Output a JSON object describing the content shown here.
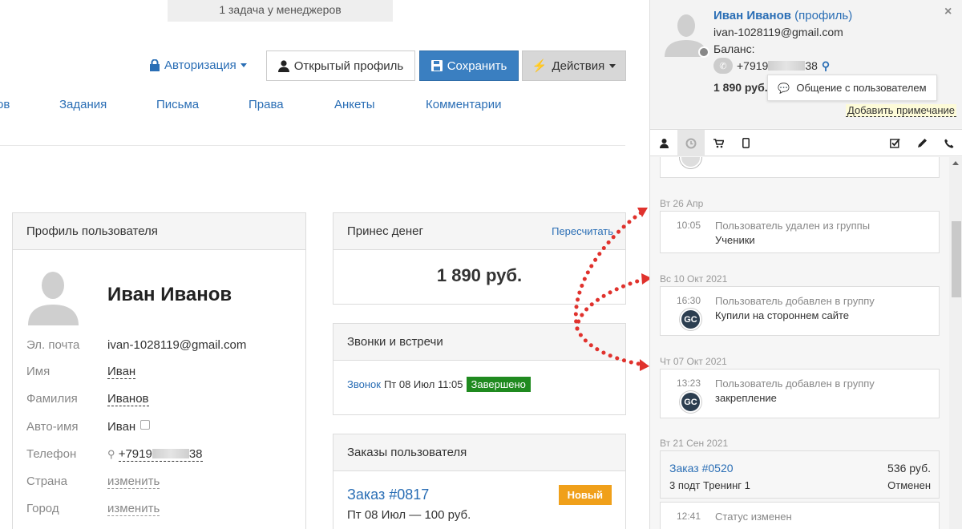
{
  "banner": {
    "text": "1 задача у менеджеров"
  },
  "toolbar": {
    "auth_label": "Авторизация",
    "open_profile_label": "Открытый профиль",
    "save_label": "Сохранить",
    "actions_label": "Действия"
  },
  "nav": {
    "items": [
      "ов",
      "Задания",
      "Письма",
      "Права",
      "Анкеты",
      "Комментарии"
    ]
  },
  "profile": {
    "title": "Профиль пользователя",
    "name": "Иван Иванов",
    "fields": [
      {
        "label": "Эл. почта",
        "value": "ivan-1028119@gmail.com"
      },
      {
        "label": "Имя",
        "value": "Иван"
      },
      {
        "label": "Фамилия",
        "value": "Иванов"
      },
      {
        "label": "Авто-имя",
        "value": "Иван"
      },
      {
        "label": "Телефон",
        "prefix": "+7919",
        "suffix": "38"
      },
      {
        "label": "Страна",
        "value": "изменить"
      },
      {
        "label": "Город",
        "value": "изменить"
      }
    ]
  },
  "money": {
    "title": "Принес денег",
    "recalc": "Пересчитать",
    "value": "1 890 руб."
  },
  "calls": {
    "title": "Звонки и встречи",
    "link": "Звонок",
    "date": "Пт 08 Июл 11:05",
    "status": "Завершено"
  },
  "orders": {
    "title": "Заказы пользователя",
    "number": "Заказ #0817",
    "status": "Новый",
    "date": "Пт 08 Июл — 100 руб."
  },
  "sidebar": {
    "name": "Иван Иванов",
    "profile_link": "(профиль)",
    "email": "ivan-1028119@gmail.com",
    "balance_label": "Баланс:",
    "phone_prefix": "+7919",
    "phone_suffix": "38",
    "sum": "1 890 руб.",
    "chat_label": "Общение с пользователем",
    "add_note": "Добавить примечание",
    "close": "×"
  },
  "feed": {
    "entries": [
      {
        "date": "Вт 26 Апр",
        "time": "10:05",
        "line1": "Пользователь удален из группы",
        "line2": "Ученики"
      },
      {
        "date": "Вс 10 Окт 2021",
        "time": "16:30",
        "line1": "Пользователь добавлен в группу",
        "line2": "Купили на стороннем сайте",
        "badge": "GC"
      },
      {
        "date": "Чт 07 Окт 2021",
        "time": "13:23",
        "line1": "Пользователь добавлен в группу",
        "line2": "закрепление",
        "badge": "GC"
      }
    ],
    "order_date": "Вт 21 Сен 2021",
    "order": {
      "number": "Заказ #0520",
      "price": "536 руб.",
      "product": "3 подт Тренинг 1",
      "status": "Отменен"
    },
    "last": {
      "time": "12:41",
      "line1": "Статус изменен"
    }
  },
  "colors": {
    "accent": "#2a6eb5",
    "save": "#3a7fc1",
    "done": "#1f8a1f",
    "new": "#f0a01a",
    "arrows": "#e0322d"
  }
}
